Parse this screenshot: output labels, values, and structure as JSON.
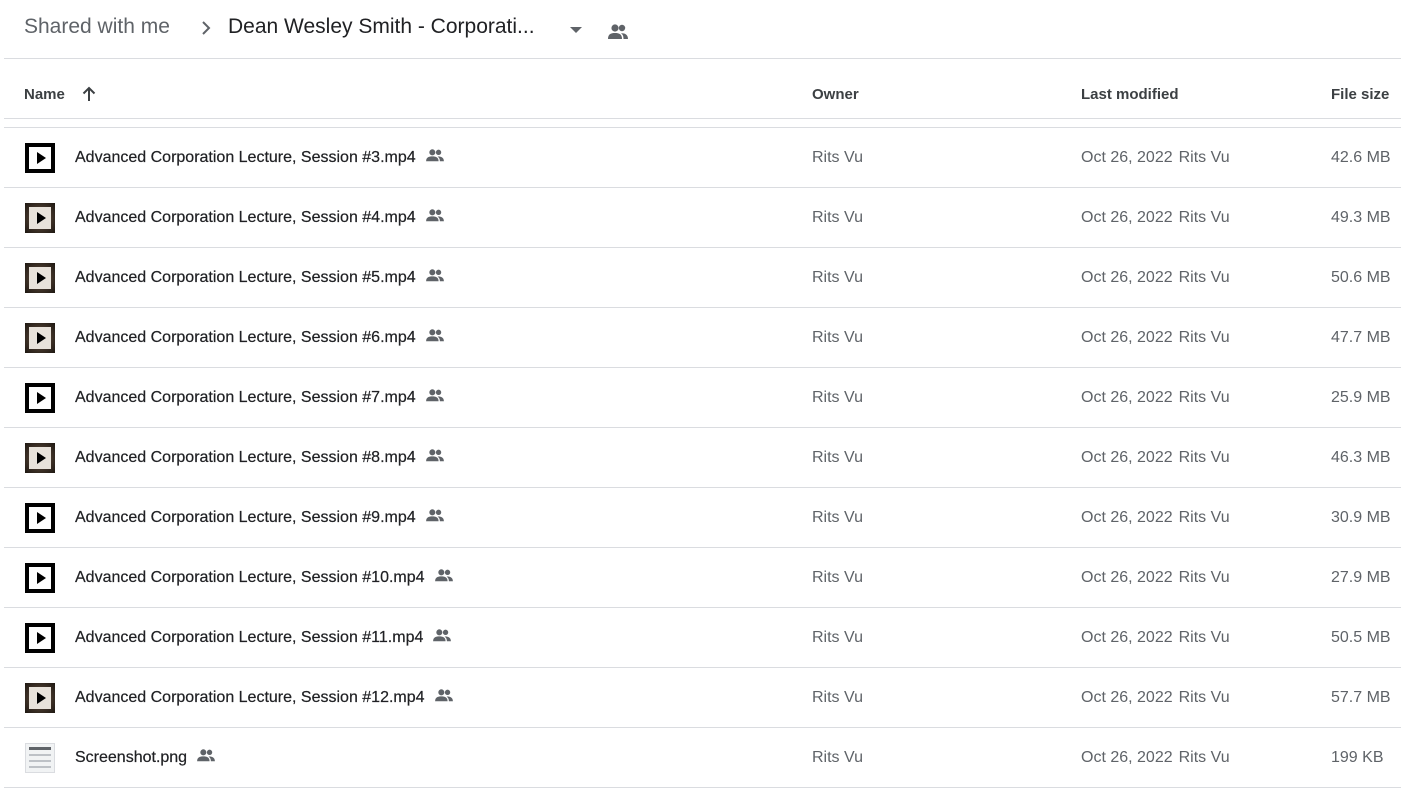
{
  "breadcrumb": {
    "root": "Shared with me",
    "current": "Dean Wesley Smith - Corporati..."
  },
  "columns": {
    "name": "Name",
    "owner": "Owner",
    "last_modified": "Last modified",
    "file_size": "File size"
  },
  "files": [
    {
      "name": "Advanced Corporation Lecture, Session #3.mp4",
      "owner": "Rits Vu",
      "date": "Oct 26, 2022",
      "modified_by": "Rits Vu",
      "size": "42.6 MB",
      "thumb": "black"
    },
    {
      "name": "Advanced Corporation Lecture, Session #4.mp4",
      "owner": "Rits Vu",
      "date": "Oct 26, 2022",
      "modified_by": "Rits Vu",
      "size": "49.3 MB",
      "thumb": "brown"
    },
    {
      "name": "Advanced Corporation Lecture, Session #5.mp4",
      "owner": "Rits Vu",
      "date": "Oct 26, 2022",
      "modified_by": "Rits Vu",
      "size": "50.6 MB",
      "thumb": "brown"
    },
    {
      "name": "Advanced Corporation Lecture, Session #6.mp4",
      "owner": "Rits Vu",
      "date": "Oct 26, 2022",
      "modified_by": "Rits Vu",
      "size": "47.7 MB",
      "thumb": "brown"
    },
    {
      "name": "Advanced Corporation Lecture, Session #7.mp4",
      "owner": "Rits Vu",
      "date": "Oct 26, 2022",
      "modified_by": "Rits Vu",
      "size": "25.9 MB",
      "thumb": "black"
    },
    {
      "name": "Advanced Corporation Lecture, Session #8.mp4",
      "owner": "Rits Vu",
      "date": "Oct 26, 2022",
      "modified_by": "Rits Vu",
      "size": "46.3 MB",
      "thumb": "brown"
    },
    {
      "name": "Advanced Corporation Lecture, Session #9.mp4",
      "owner": "Rits Vu",
      "date": "Oct 26, 2022",
      "modified_by": "Rits Vu",
      "size": "30.9 MB",
      "thumb": "black"
    },
    {
      "name": "Advanced Corporation Lecture, Session #10.mp4",
      "owner": "Rits Vu",
      "date": "Oct 26, 2022",
      "modified_by": "Rits Vu",
      "size": "27.9 MB",
      "thumb": "black"
    },
    {
      "name": "Advanced Corporation Lecture, Session #11.mp4",
      "owner": "Rits Vu",
      "date": "Oct 26, 2022",
      "modified_by": "Rits Vu",
      "size": "50.5 MB",
      "thumb": "black"
    },
    {
      "name": "Advanced Corporation Lecture, Session #12.mp4",
      "owner": "Rits Vu",
      "date": "Oct 26, 2022",
      "modified_by": "Rits Vu",
      "size": "57.7 MB",
      "thumb": "brown"
    },
    {
      "name": "Screenshot.png",
      "owner": "Rits Vu",
      "date": "Oct 26, 2022",
      "modified_by": "Rits Vu",
      "size": "199 KB",
      "thumb": "image"
    }
  ],
  "icons": {
    "breadcrumb_separator": "chevron-right-icon",
    "dropdown": "arrow-drop-down-icon",
    "shared": "people-icon",
    "sort": "arrow-up-icon"
  },
  "colors": {
    "text_primary": "#202124",
    "text_secondary": "#5f6368",
    "divider": "#dadce0"
  }
}
